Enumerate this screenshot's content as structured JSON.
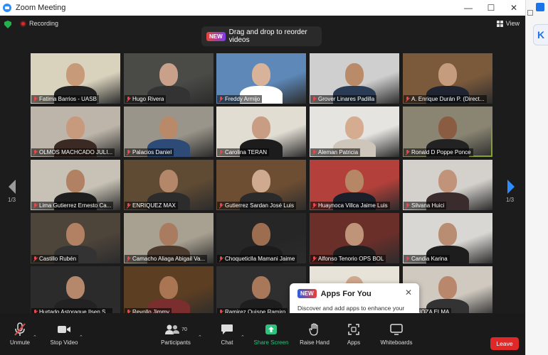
{
  "window": {
    "title": "Zoom Meeting",
    "controls": [
      "—",
      "☐",
      "✕"
    ]
  },
  "topbar": {
    "recording_label": "Recording",
    "view_label": "View"
  },
  "drag_tip": {
    "badge": "NEW",
    "text": "Drag and drop to reorder videos"
  },
  "paging": {
    "left": "1/3",
    "right": "1/3"
  },
  "participants": [
    {
      "name": "Fatima Barrios - UASB",
      "bg": "#d9d2bd",
      "skin": "#c79a7a",
      "shirt": "#222"
    },
    {
      "name": "Hugo Rivera",
      "bg": "#4a4a46",
      "skin": "#c9a08a",
      "shirt": "#333"
    },
    {
      "name": "Freddy Armijo",
      "bg": "#5d88b8",
      "skin": "#d8b39a",
      "shirt": "#fff"
    },
    {
      "name": "Grover Linares Padilla",
      "bg": "#cfcfcf",
      "skin": "#b98b69",
      "shirt": "#2a3c55"
    },
    {
      "name": "A. Enrique Durán P. (Direct...",
      "bg": "#7b5a3c",
      "skin": "#c69c7e",
      "shirt": "#1e2430"
    },
    {
      "name": "OLMOS MACHCADO JULI...",
      "bg": "#bdb5aa",
      "skin": "#c7997d",
      "shirt": "#3b2a23"
    },
    {
      "name": "Palacios Daniel",
      "bg": "#9a958a",
      "skin": "#b98a6a",
      "shirt": "#2e4a77"
    },
    {
      "name": "Carolina TERAN",
      "bg": "#e2ddd3",
      "skin": "#c99d83",
      "shirt": "#1c1c1c"
    },
    {
      "name": "Aleman Patricia",
      "bg": "#e6e4e0",
      "skin": "#d6ac90",
      "shirt": "#cfc6bb"
    },
    {
      "name": "Ronald D Poppe Ponce",
      "bg": "#8a8573",
      "skin": "#8a5c41",
      "shirt": "#222"
    },
    {
      "name": "Lima Gutierrez Ernesto Ca...",
      "bg": "#c7c2b5",
      "skin": "#b28062",
      "shirt": "#1e1e1e"
    },
    {
      "name": "ENRIQUEZ MAX",
      "bg": "#5f4a34",
      "skin": "#b5876a",
      "shirt": "#2c2c2c"
    },
    {
      "name": "Gutierrez Sardan José Luis",
      "bg": "#6e4e33",
      "skin": "#d0aa8e",
      "shirt": "#2a2a2a"
    },
    {
      "name": "Huaynoca Villca Jaime Luis",
      "bg": "#b3403a",
      "skin": "#b68767",
      "shirt": "#1b1f2a"
    },
    {
      "name": "Silvana Huici",
      "bg": "#d4d1cc",
      "skin": "#c1937a",
      "shirt": "#3a2c2c"
    },
    {
      "name": "Castillo Rubén",
      "bg": "#4d443a",
      "skin": "#b28063",
      "shirt": "#333"
    },
    {
      "name": "Camacho Aliaga Abigail Va...",
      "bg": "#a8a091",
      "skin": "#a97b5f",
      "shirt": "#4b3a2e"
    },
    {
      "name": "Choqueticlla Mamani Jaime",
      "bg": "#262626",
      "skin": "#9d6d4f",
      "shirt": "#1c1c1c"
    },
    {
      "name": "Alfonso Tenorio OPS BOL",
      "bg": "#6b2f2a",
      "skin": "#bf9478",
      "shirt": "#1e1e1e"
    },
    {
      "name": "Candia Karina",
      "bg": "#d9d7d3",
      "skin": "#b98d71",
      "shirt": "#1d1d1d"
    },
    {
      "name": "Hurtado Astoraque Ilsen S...",
      "bg": "#2b2b2b",
      "skin": "#b5876b",
      "shirt": "#222"
    },
    {
      "name": "Revollo Jimmy",
      "bg": "#5c3e22",
      "skin": "#a97552",
      "shirt": "#7a2e2e"
    },
    {
      "name": "Ramirez Quispe Ramiro",
      "bg": "#2f2f2f",
      "skin": "#a9785a",
      "shirt": "#1e1e1e"
    },
    {
      "name": "",
      "bg": "#e8e3d9",
      "skin": "#d0a88d",
      "shirt": "#ddd"
    },
    {
      "name": "PINOZA ELMA",
      "bg": "#cfc9c0",
      "skin": "#b9886c",
      "shirt": "#333"
    }
  ],
  "apps_popover": {
    "badge": "NEW",
    "title": "Apps For You",
    "description": "Discover and add apps to enhance your Zoom experience",
    "close": "✕"
  },
  "toolbar": {
    "unmute": "Unmute",
    "stop_video": "Stop Video",
    "participants": "Participants",
    "participants_count": "70",
    "chat": "Chat",
    "share_screen": "Share Screen",
    "raise_hand": "Raise Hand",
    "apps": "Apps",
    "whiteboards": "Whiteboards",
    "leave": "Leave"
  },
  "colors": {
    "meeting_bg": "#1c1c1c",
    "active_speaker": "#aee02c",
    "share_green": "#2ec27e",
    "leave_red": "#e02828",
    "muted_red": "#e5484d"
  }
}
